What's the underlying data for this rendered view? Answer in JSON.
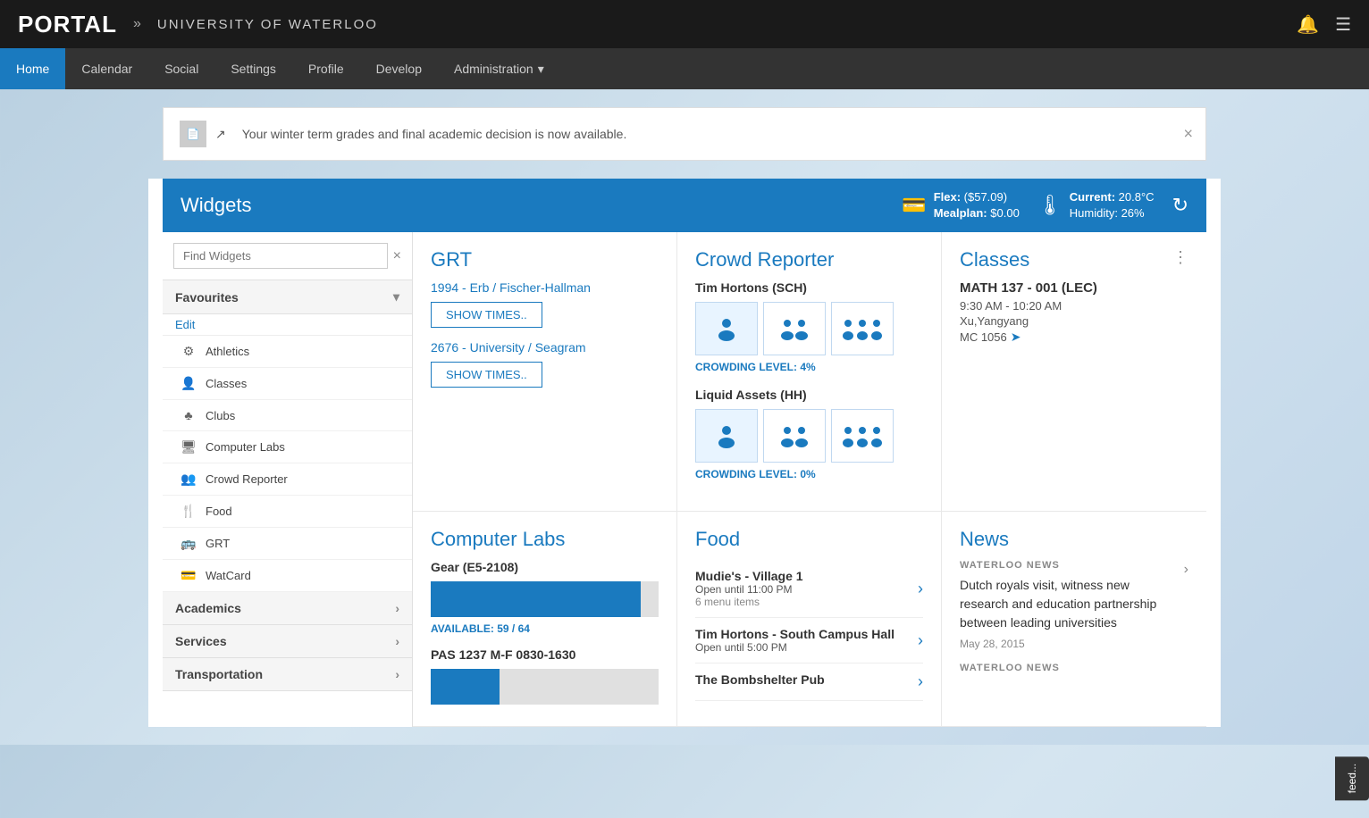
{
  "topbar": {
    "logo": "PORTAL",
    "chevrons": "»",
    "university": "UNIVERSITY OF WATERLOO",
    "bell_icon": "🔔",
    "menu_icon": "☰"
  },
  "nav": {
    "items": [
      {
        "label": "Home",
        "active": true
      },
      {
        "label": "Calendar",
        "active": false
      },
      {
        "label": "Social",
        "active": false
      },
      {
        "label": "Settings",
        "active": false
      },
      {
        "label": "Profile",
        "active": false
      },
      {
        "label": "Develop",
        "active": false
      },
      {
        "label": "Administration",
        "active": false,
        "has_caret": true
      }
    ]
  },
  "notification": {
    "text": "Your winter term grades and final academic decision is now available.",
    "link_icon": "↗"
  },
  "widgets_header": {
    "title": "Widgets",
    "flex_label": "Flex:",
    "flex_value": "($57.09)",
    "mealplan_label": "Mealplan:",
    "mealplan_value": "$0.00",
    "temp_label": "Current:",
    "temp_value": "20.8°C",
    "humidity_label": "Humidity:",
    "humidity_value": "26%",
    "refresh_icon": "↻"
  },
  "sidebar": {
    "search_placeholder": "Find Widgets",
    "sections": {
      "favourites": {
        "label": "Favourites",
        "edit_label": "Edit",
        "items": [
          {
            "label": "Athletics",
            "icon": "⚙"
          },
          {
            "label": "Classes",
            "icon": "👤"
          },
          {
            "label": "Clubs",
            "icon": "♣"
          },
          {
            "label": "Computer Labs",
            "icon": "🖥"
          },
          {
            "label": "Crowd Reporter",
            "icon": "👥"
          },
          {
            "label": "Food",
            "icon": "🍴"
          },
          {
            "label": "GRT",
            "icon": "🚌"
          },
          {
            "label": "WatCard",
            "icon": "💳"
          }
        ]
      },
      "academics": {
        "label": "Academics"
      },
      "services": {
        "label": "Services"
      },
      "transportation": {
        "label": "Transportation"
      }
    }
  },
  "grt_widget": {
    "title": "GRT",
    "route1": "1994 - Erb / Fischer-Hallman",
    "route2": "2676 - University / Seagram",
    "show_times_label": "SHOW TIMES.."
  },
  "crowd_widget": {
    "title": "Crowd Reporter",
    "location1": {
      "name": "Tim Hortons (SCH)",
      "level": "4%",
      "level_label": "CROWDING LEVEL:"
    },
    "location2": {
      "name": "Liquid Assets (HH)",
      "level": "0%",
      "level_label": "CROWDING LEVEL:"
    }
  },
  "classes_widget": {
    "title": "Classes",
    "menu_icon": "⋮",
    "course": "MATH 137 - 001 (LEC)",
    "time": "9:30 AM - 10:20 AM",
    "instructor": "Xu,Yangyang",
    "room": "MC 1056",
    "nav_icon": "➤"
  },
  "computer_labs_widget": {
    "title": "Computer Labs",
    "lab1": {
      "name": "Gear (E5-2108)",
      "available_label": "AVAILABLE:",
      "available": "59 / 64",
      "bar_percent": 92
    },
    "lab2": {
      "name": "PAS 1237 M-F 0830-1630",
      "bar_percent": 30
    }
  },
  "food_widget": {
    "title": "Food",
    "items": [
      {
        "name": "Mudie's - Village 1",
        "hours": "Open until 11:00 PM",
        "menu": "6 menu items"
      },
      {
        "name": "Tim Hortons - South Campus Hall",
        "hours": "Open until 5:00 PM",
        "menu": ""
      },
      {
        "name": "The Bombshelter Pub",
        "hours": "",
        "menu": ""
      }
    ]
  },
  "news_widget": {
    "title": "News",
    "source1": "WATERLOO NEWS",
    "headline1": "Dutch royals visit, witness new research and education partnership between leading universities",
    "date1": "May 28, 2015",
    "source2": "WATERLOO NEWS",
    "chevron": "›"
  },
  "feedback": {
    "label": "feed..."
  }
}
